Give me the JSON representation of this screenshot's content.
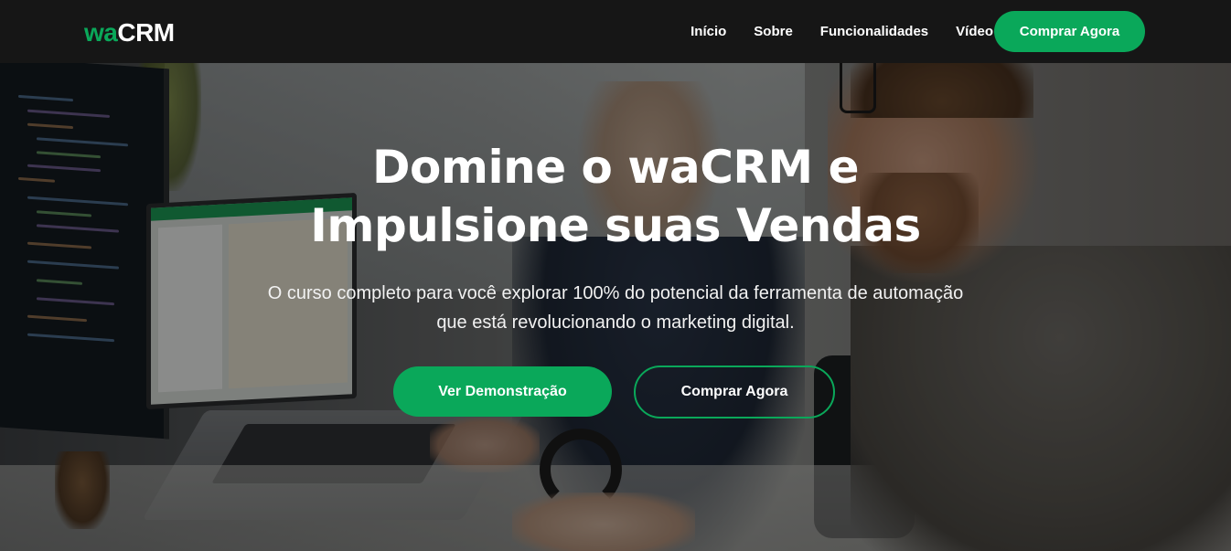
{
  "navbar": {
    "logo": {
      "accent": "wa",
      "main": "CRM"
    },
    "links": [
      {
        "label": "Início"
      },
      {
        "label": "Sobre"
      },
      {
        "label": "Funcionalidades"
      },
      {
        "label": "Vídeo"
      }
    ],
    "cta_label": "Comprar Agora"
  },
  "hero": {
    "title_lines": [
      "Domine o waCRM e",
      "Impulsione suas Vendas"
    ],
    "subtitle_lines": [
      "O curso completo para você explorar 100% do potencial da ferramenta de automação",
      "que está revolucionando o marketing digital."
    ],
    "primary_button": "Ver Demonstração",
    "secondary_button": "Comprar Agora"
  },
  "colors": {
    "accent": "#0aa85a",
    "navbar_bg": "#161616",
    "text": "#ffffff"
  }
}
